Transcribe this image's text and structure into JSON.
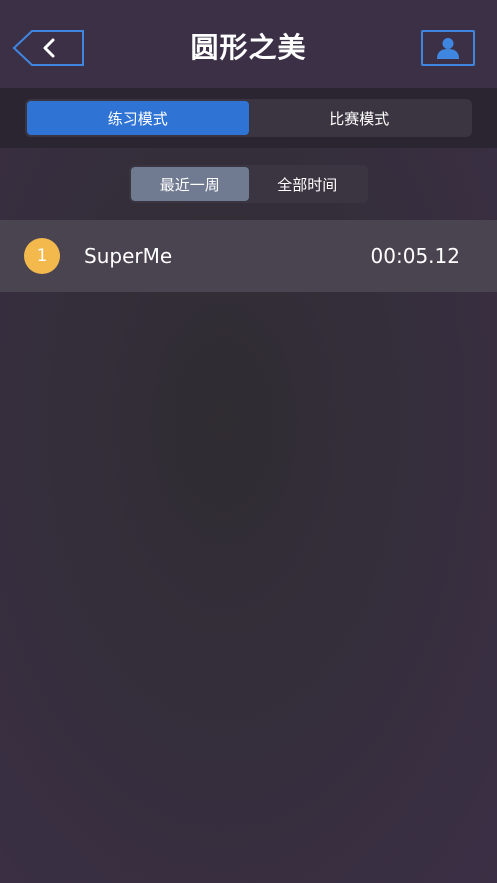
{
  "header": {
    "title": "圆形之美",
    "accent_color": "#3f86e0"
  },
  "mode_tabs": {
    "items": [
      {
        "label": "练习模式",
        "active": true
      },
      {
        "label": "比赛模式",
        "active": false
      }
    ],
    "active_color": "#2f74d4"
  },
  "time_tabs": {
    "items": [
      {
        "label": "最近一周",
        "active": true
      },
      {
        "label": "全部时间",
        "active": false
      }
    ]
  },
  "leaderboard": [
    {
      "rank": "1",
      "name": "SuperMe",
      "time": "00:05.12",
      "badge_color": "#f3b94d"
    }
  ],
  "icons": {
    "back": "chevron-left-icon",
    "user": "user-icon"
  }
}
